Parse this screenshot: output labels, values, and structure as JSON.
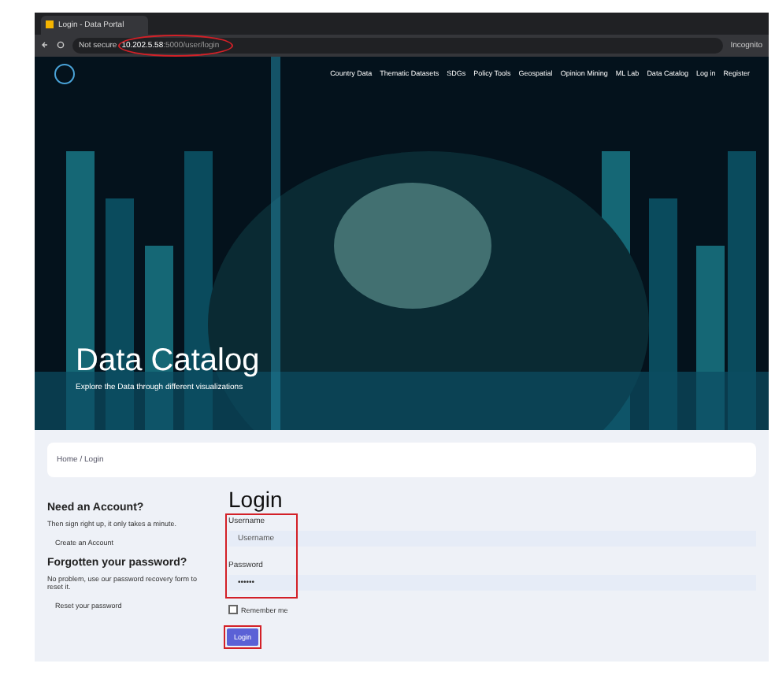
{
  "browser": {
    "tab_title": "Login - Data Portal",
    "security": "Not secure",
    "url_host": "10.202.5.58",
    "url_path": ":5000/user/login",
    "profile": "Incognito"
  },
  "nav": [
    "Country Data",
    "Thematic Datasets",
    "SDGs",
    "Policy Tools",
    "Geospatial",
    "Opinion Mining",
    "ML Lab",
    "Data Catalog",
    "Log in",
    "Register"
  ],
  "hero": {
    "kind": "picture",
    "title": "Data Catalog",
    "subtitle": "Explore the Data through different visualizations"
  },
  "breadcrumb": "Home / Login",
  "sidebar": [
    {
      "heading": "Need an Account?",
      "text": "Then sign right up, it only takes a minute.",
      "link": "Create an Account"
    },
    {
      "heading": "Forgotten your password?",
      "text": "No problem, use our password recovery form to reset it.",
      "link": "Reset your password"
    }
  ],
  "form": {
    "title": "Login",
    "username_label": "Username",
    "username_placeholder": "Username",
    "password_label": "Password",
    "password_value": "••••••",
    "remember": {
      "label": "Remember me",
      "checked": false
    },
    "submit": "Login"
  }
}
